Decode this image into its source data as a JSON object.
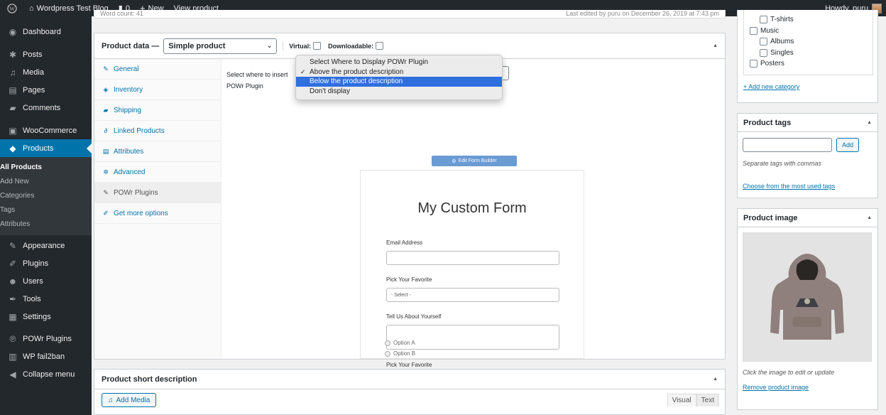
{
  "adminbar": {
    "site_name": "Wordpress Test Blog",
    "comments_count": "0",
    "new_label": "New",
    "view_label": "View product",
    "howdy": "Howdy, puru"
  },
  "sidebar": {
    "items": [
      {
        "label": "Dashboard",
        "icon": "dashboard-icon"
      },
      {
        "label": "Posts",
        "icon": "pin-icon"
      },
      {
        "label": "Media",
        "icon": "media-icon"
      },
      {
        "label": "Pages",
        "icon": "pages-icon"
      },
      {
        "label": "Comments",
        "icon": "comment-icon"
      },
      {
        "label": "WooCommerce",
        "icon": "woocommerce-icon"
      },
      {
        "label": "Products",
        "icon": "products-icon"
      },
      {
        "label": "Appearance",
        "icon": "brush-icon"
      },
      {
        "label": "Plugins",
        "icon": "plugin-icon"
      },
      {
        "label": "Users",
        "icon": "users-icon"
      },
      {
        "label": "Tools",
        "icon": "wrench-icon"
      },
      {
        "label": "Settings",
        "icon": "settings-icon"
      },
      {
        "label": "POWr Plugins",
        "icon": "powr-icon"
      },
      {
        "label": "WP fail2ban",
        "icon": "fail2ban-icon"
      },
      {
        "label": "Collapse menu",
        "icon": "collapse-icon"
      }
    ],
    "submenu": [
      "All Products",
      "Add New",
      "Categories",
      "Tags",
      "Attributes"
    ]
  },
  "editor": {
    "word_count": "Word count: 41",
    "last_edited": "Last edited by puru on December 26, 2019 at 7:43 pm"
  },
  "product_data": {
    "title": "Product data —",
    "type_select": "Simple product",
    "virtual_label": "Virtual:",
    "downloadable_label": "Downloadable:",
    "tabs": [
      {
        "label": "General",
        "icon": "wrench-icon"
      },
      {
        "label": "Inventory",
        "icon": "tag-icon"
      },
      {
        "label": "Shipping",
        "icon": "truck-icon"
      },
      {
        "label": "Linked Products",
        "icon": "link-icon"
      },
      {
        "label": "Attributes",
        "icon": "list-icon"
      },
      {
        "label": "Advanced",
        "icon": "gear-icon"
      },
      {
        "label": "POWr Plugins",
        "icon": "wrench-icon"
      },
      {
        "label": "Get more options",
        "icon": "plug-icon"
      }
    ],
    "insert_label_line1": "Select where to insert",
    "insert_label_line2": "POWr Plugin",
    "edit_button": "Edit Form Builder",
    "dropdown": {
      "options": [
        "Select Where to Display POWr Plugin",
        "Above the product description",
        "Below the product description",
        "Don't display"
      ],
      "checked_index": 1,
      "highlighted_index": 2
    },
    "form": {
      "title": "My Custom Form",
      "email_label": "Email Address",
      "favorite_label": "Pick Your Favorite",
      "favorite_select": "- Select -",
      "about_label": "Tell Us About Yourself",
      "radio_label": "Pick Your Favorite",
      "option_a": "Option A",
      "option_b": "Option B"
    }
  },
  "short_desc": {
    "title": "Product short description",
    "add_media": "Add Media",
    "visual_tab": "Visual",
    "text_tab": "Text"
  },
  "categories": {
    "items": [
      "T-shirts",
      "Music",
      "Albums",
      "Singles",
      "Posters"
    ],
    "add_new": "+ Add new category"
  },
  "tags": {
    "title": "Product tags",
    "add_button": "Add",
    "hint": "Separate tags with commas",
    "choose_link": "Choose from the most used tags"
  },
  "product_image": {
    "title": "Product image",
    "hint": "Click the image to edit or update",
    "remove_link": "Remove product image"
  }
}
